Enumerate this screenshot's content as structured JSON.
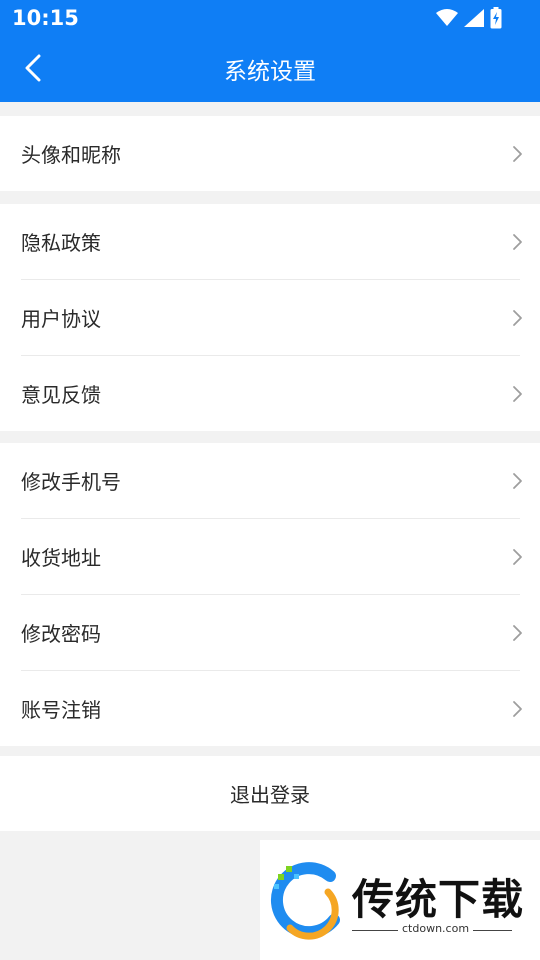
{
  "status_bar": {
    "time": "10:15"
  },
  "header": {
    "title": "系统设置"
  },
  "group1": [
    {
      "label": "头像和昵称"
    }
  ],
  "group2": [
    {
      "label": "隐私政策"
    },
    {
      "label": "用户协议"
    },
    {
      "label": "意见反馈"
    }
  ],
  "group3": [
    {
      "label": "修改手机号"
    },
    {
      "label": "收货地址"
    },
    {
      "label": "修改密码"
    },
    {
      "label": "账号注销"
    }
  ],
  "logout": {
    "label": "退出登录"
  },
  "watermark": {
    "brand": "传统下载",
    "url": "ctdown.com"
  },
  "colors": {
    "header_bg": "#0f7ef5",
    "text": "#2a2a2a",
    "divider": "#eaeaea",
    "chevron": "#9e9e9e"
  }
}
